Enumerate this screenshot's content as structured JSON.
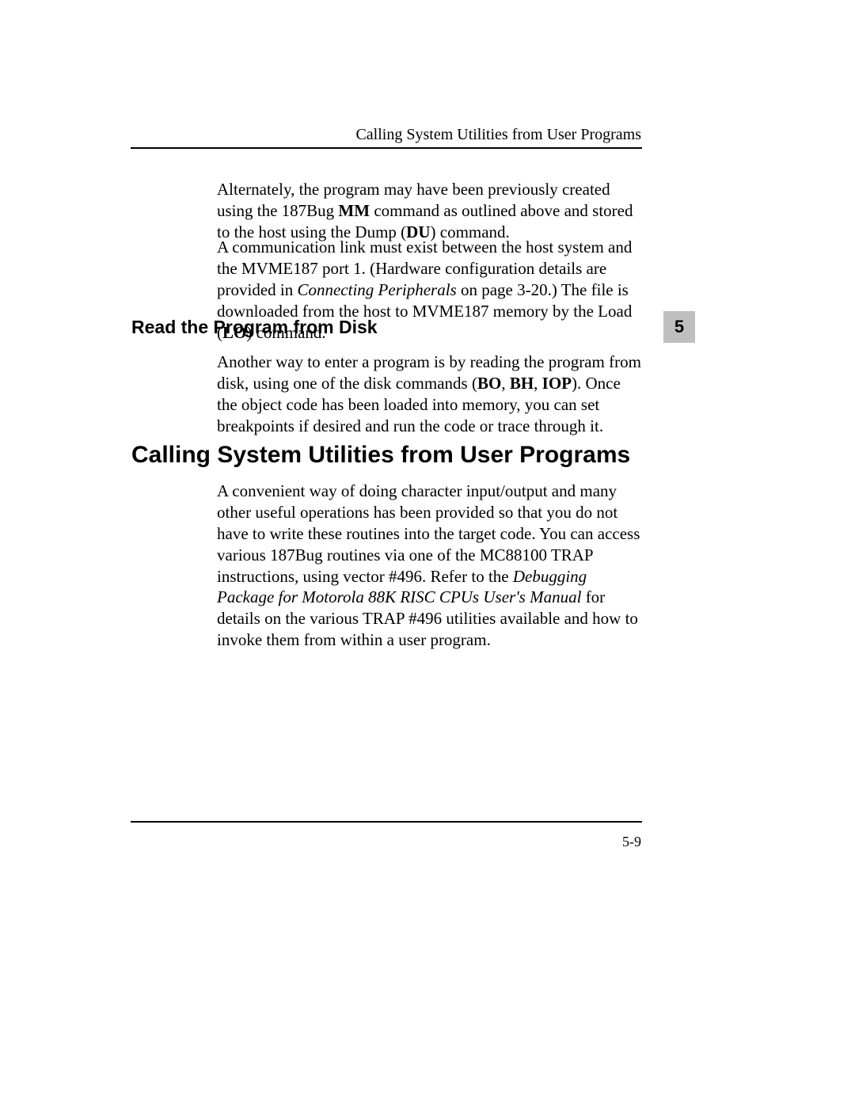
{
  "header": {
    "running_title": "Calling System Utilities from User Programs"
  },
  "chapter_tab": "5",
  "footer": {
    "page_number": "5-9"
  },
  "para1": {
    "t1": "Alternately, the program may have been previously created using the 187Bug ",
    "b1": "MM",
    "t2": " command as outlined above and stored to the host using the Dump (",
    "b2": "DU",
    "t3": ") command."
  },
  "para2": {
    "t1": "A communication link must exist between the host system and the MVME187 port 1. (Hardware configuration details are provided in ",
    "i1": "Connecting Peripherals",
    "t2": " on page 3-20.) The file is downloaded from the host to MVME187 memory by the Load (",
    "b1": "LO",
    "t3": ") command."
  },
  "heading2": "Read the Program from Disk",
  "para3": {
    "t1": "Another way to enter a program is by reading the program from disk, using one of the disk commands (",
    "b1": "BO",
    "t2": ", ",
    "b2": "BH",
    "t3": ", ",
    "b3": "IOP",
    "t4": "). Once the object code has been loaded into memory, you can set breakpoints if desired and run the code or trace through it."
  },
  "heading1": "Calling System Utilities from User Programs",
  "para4": {
    "t1": "A convenient way of doing character input/output and many other useful operations has been provided so that you do not have to write these routines into the target code. You can access various 187Bug routines via one of the MC88100 TRAP instructions, using vector #496. Refer to the ",
    "i1": "Debugging Package for Motorola 88K RISC CPUs User's Manual",
    "t2": " for details on the various TRAP #496 utilities available and how to invoke them from within a user program."
  }
}
